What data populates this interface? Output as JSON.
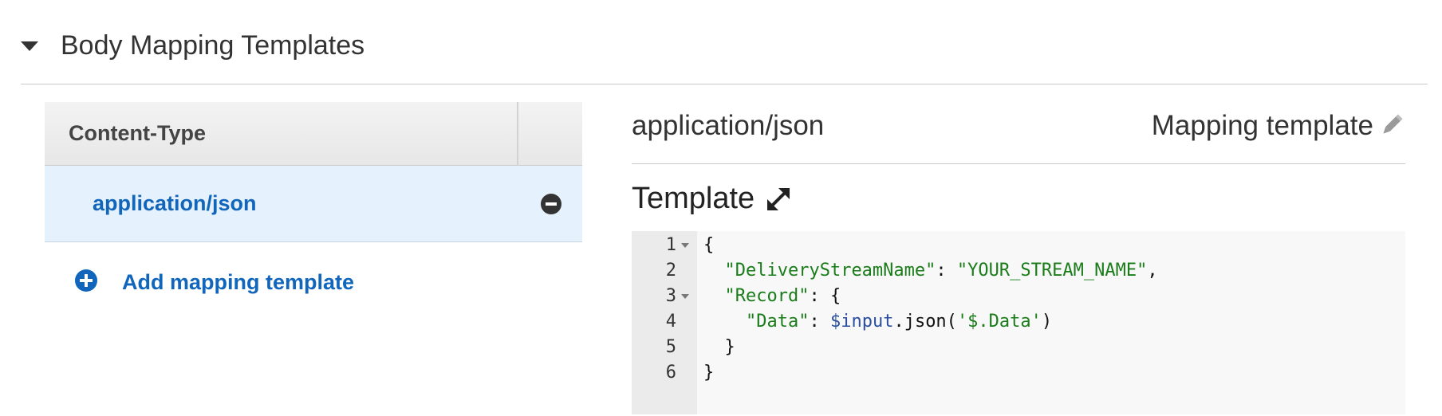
{
  "section": {
    "title": "Body Mapping Templates"
  },
  "content_type_table": {
    "header": "Content-Type",
    "rows": [
      {
        "label": "application/json"
      }
    ],
    "add_label": "Add mapping template"
  },
  "panel": {
    "content_type": "application/json",
    "mapping_label": "Mapping template",
    "template_title": "Template"
  },
  "editor": {
    "lines": [
      {
        "num": "1",
        "fold": true,
        "indent": "",
        "parts": [
          {
            "t": "{",
            "c": "plain"
          }
        ]
      },
      {
        "num": "2",
        "fold": false,
        "indent": "  ",
        "parts": [
          {
            "t": "\"DeliveryStreamName\"",
            "c": "str"
          },
          {
            "t": ": ",
            "c": "plain"
          },
          {
            "t": "\"YOUR_STREAM_NAME\"",
            "c": "str"
          },
          {
            "t": ",",
            "c": "plain"
          }
        ]
      },
      {
        "num": "3",
        "fold": true,
        "indent": "  ",
        "parts": [
          {
            "t": "\"Record\"",
            "c": "str"
          },
          {
            "t": ": {",
            "c": "plain"
          }
        ]
      },
      {
        "num": "4",
        "fold": false,
        "indent": "    ",
        "parts": [
          {
            "t": "\"Data\"",
            "c": "str"
          },
          {
            "t": ": ",
            "c": "plain"
          },
          {
            "t": "$input",
            "c": "var"
          },
          {
            "t": ".json(",
            "c": "plain"
          },
          {
            "t": "'$.Data'",
            "c": "str"
          },
          {
            "t": ")",
            "c": "plain"
          }
        ]
      },
      {
        "num": "5",
        "fold": false,
        "indent": "  ",
        "parts": [
          {
            "t": "}",
            "c": "plain"
          }
        ]
      },
      {
        "num": "6",
        "fold": false,
        "indent": "",
        "parts": [
          {
            "t": "}",
            "c": "plain"
          }
        ]
      }
    ]
  },
  "icons": {
    "collapse": "caret-down-icon",
    "remove": "minus-circle-icon",
    "add": "plus-circle-icon",
    "edit": "pencil-icon",
    "expand": "expand-arrows-icon"
  },
  "colors": {
    "link": "#1166bb",
    "selected_row": "#e5f1fc",
    "string": "#1a7d1a",
    "variable": "#2b4f9e",
    "editor_bg": "#f8f8f8",
    "gutter_bg": "#ebebeb"
  }
}
